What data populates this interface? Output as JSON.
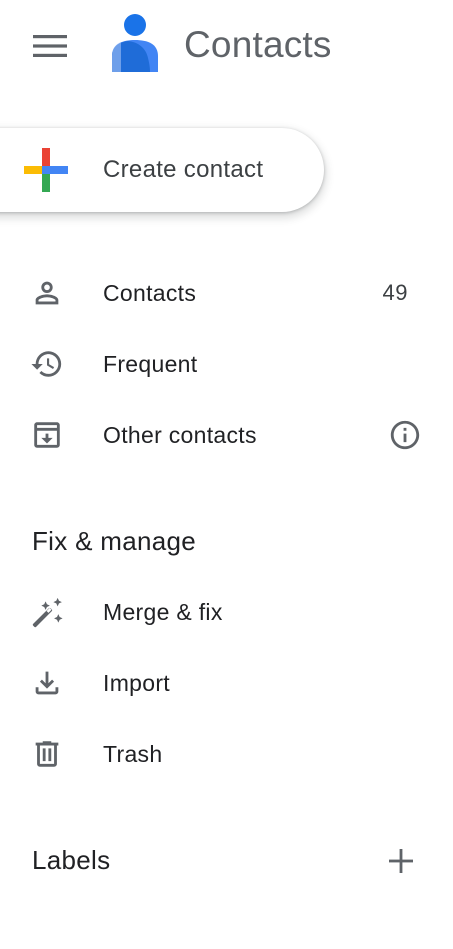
{
  "header": {
    "menu_icon": "hamburger-menu-icon",
    "logo_icon": "contacts-person-icon",
    "title": "Contacts",
    "logo_colors": {
      "head": "#1a73e8",
      "body_light": "#4285f4",
      "body_dark": "#1967d2"
    }
  },
  "create": {
    "label": "Create contact",
    "icon": "multicolor-plus-icon",
    "plus_colors": {
      "top": "#ea4335",
      "right": "#4285f4",
      "bottom": "#34a853",
      "left": "#fbbc04"
    }
  },
  "nav": [
    {
      "label": "Contacts",
      "count": "49",
      "icon": "person-icon"
    },
    {
      "label": "Frequent",
      "icon": "history-icon"
    },
    {
      "label": "Other contacts",
      "icon": "archive-icon",
      "trailing_icon": "info-icon"
    }
  ],
  "fix_manage": {
    "title": "Fix & manage",
    "items": [
      {
        "label": "Merge & fix",
        "icon": "magic-wand-icon"
      },
      {
        "label": "Import",
        "icon": "download-icon"
      },
      {
        "label": "Trash",
        "icon": "trash-icon"
      }
    ]
  },
  "labels": {
    "title": "Labels",
    "add_icon": "plus-icon"
  },
  "colors": {
    "icon_gray": "#5f6368",
    "text": "#202124"
  }
}
